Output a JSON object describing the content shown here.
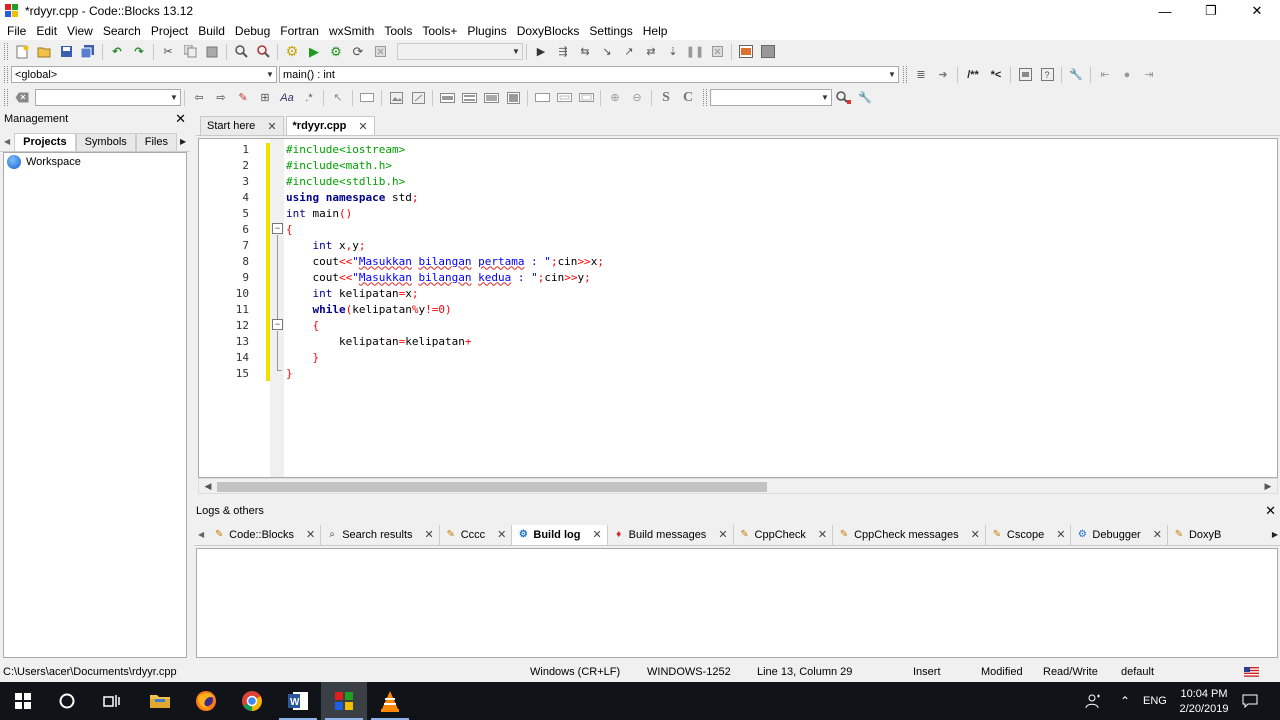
{
  "window": {
    "title": "*rdyyr.cpp - Code::Blocks 13.12",
    "minimize": "—",
    "restore": "❐",
    "close": "✕"
  },
  "menu": [
    "File",
    "Edit",
    "View",
    "Search",
    "Project",
    "Build",
    "Debug",
    "Fortran",
    "wxSmith",
    "Tools",
    "Tools+",
    "Plugins",
    "DoxyBlocks",
    "Settings",
    "Help"
  ],
  "toolbar2": {
    "scope": "<global>",
    "function": "main() : int",
    "comment_block": "/**",
    "comment_line": "*<"
  },
  "management": {
    "title": "Management",
    "tabs": [
      "Projects",
      "Symbols",
      "Files"
    ],
    "workspace": "Workspace"
  },
  "editor": {
    "tabs": [
      {
        "label": "Start here",
        "active": false
      },
      {
        "label": "*rdyyr.cpp",
        "active": true
      }
    ],
    "line_numbers": [
      "1",
      "2",
      "3",
      "4",
      "5",
      "6",
      "7",
      "8",
      "9",
      "10",
      "11",
      "12",
      "13",
      "14",
      "15"
    ]
  },
  "logs": {
    "title": "Logs & others",
    "tabs": [
      {
        "label": "Code::Blocks",
        "icon": "pencil-icon"
      },
      {
        "label": "Search results",
        "icon": "magnifier-icon"
      },
      {
        "label": "Cccc",
        "icon": "pencil-icon"
      },
      {
        "label": "Build log",
        "icon": "gear-icon",
        "active": true
      },
      {
        "label": "Build messages",
        "icon": "pin-icon"
      },
      {
        "label": "CppCheck",
        "icon": "pencil-icon"
      },
      {
        "label": "CppCheck messages",
        "icon": "pencil-icon"
      },
      {
        "label": "Cscope",
        "icon": "pencil-icon"
      },
      {
        "label": "Debugger",
        "icon": "gear-icon"
      },
      {
        "label": "DoxyB",
        "icon": "pencil-icon"
      }
    ]
  },
  "status": {
    "path": "C:\\Users\\acer\\Documents\\rdyyr.cpp",
    "eol": "Windows (CR+LF)",
    "encoding": "WINDOWS-1252",
    "position": "Line 13, Column 29",
    "mode": "Insert",
    "modified": "Modified",
    "access": "Read/Write",
    "profile": "default"
  },
  "taskbar": {
    "language": "ENG",
    "time": "10:04 PM",
    "date": "2/20/2019"
  },
  "colors": {
    "preprocessor": "#00a000",
    "keyword": "#00008b",
    "string": "#0000ff",
    "operator": "#ff0000",
    "modified_marker": "#f0e000",
    "taskbar": "#101418"
  }
}
